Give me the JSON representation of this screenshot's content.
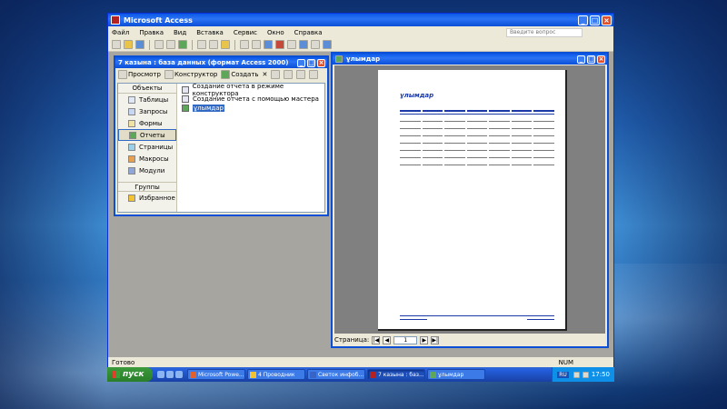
{
  "app": {
    "title": "Microsoft Access",
    "menu": [
      "Файл",
      "Правка",
      "Вид",
      "Вставка",
      "Сервис",
      "Окно",
      "Справка"
    ],
    "help_placeholder": "Введите вопрос",
    "status_left": "Готово",
    "status_right": "NUM"
  },
  "db_window": {
    "title": "7 казына : база данных (формат Access 2000)",
    "toolbar": {
      "preview": "Просмотр",
      "design": "Конструктор",
      "create": "Создать"
    },
    "objects_header": "Объекты",
    "objects": [
      "Таблицы",
      "Запросы",
      "Формы",
      "Отчеты",
      "Страницы",
      "Макросы",
      "Модули"
    ],
    "groups_header": "Группы",
    "groups": [
      "Избранное"
    ],
    "items": [
      "Создание отчета в режиме конструктора",
      "Создание отчета с помощью мастера",
      "ұлымдар"
    ]
  },
  "report_window": {
    "title": "ұлымдар",
    "report_title": "ұлымдар",
    "page_label": "Страница:",
    "page_value": "1"
  },
  "taskbar": {
    "start": "пуск",
    "buttons": [
      "Microsoft Powe...",
      "4 Проводник",
      "Светок инфоб...",
      "7 казына : баз...",
      "ұлымдар"
    ],
    "lang": "RU",
    "clock": "17:50"
  }
}
